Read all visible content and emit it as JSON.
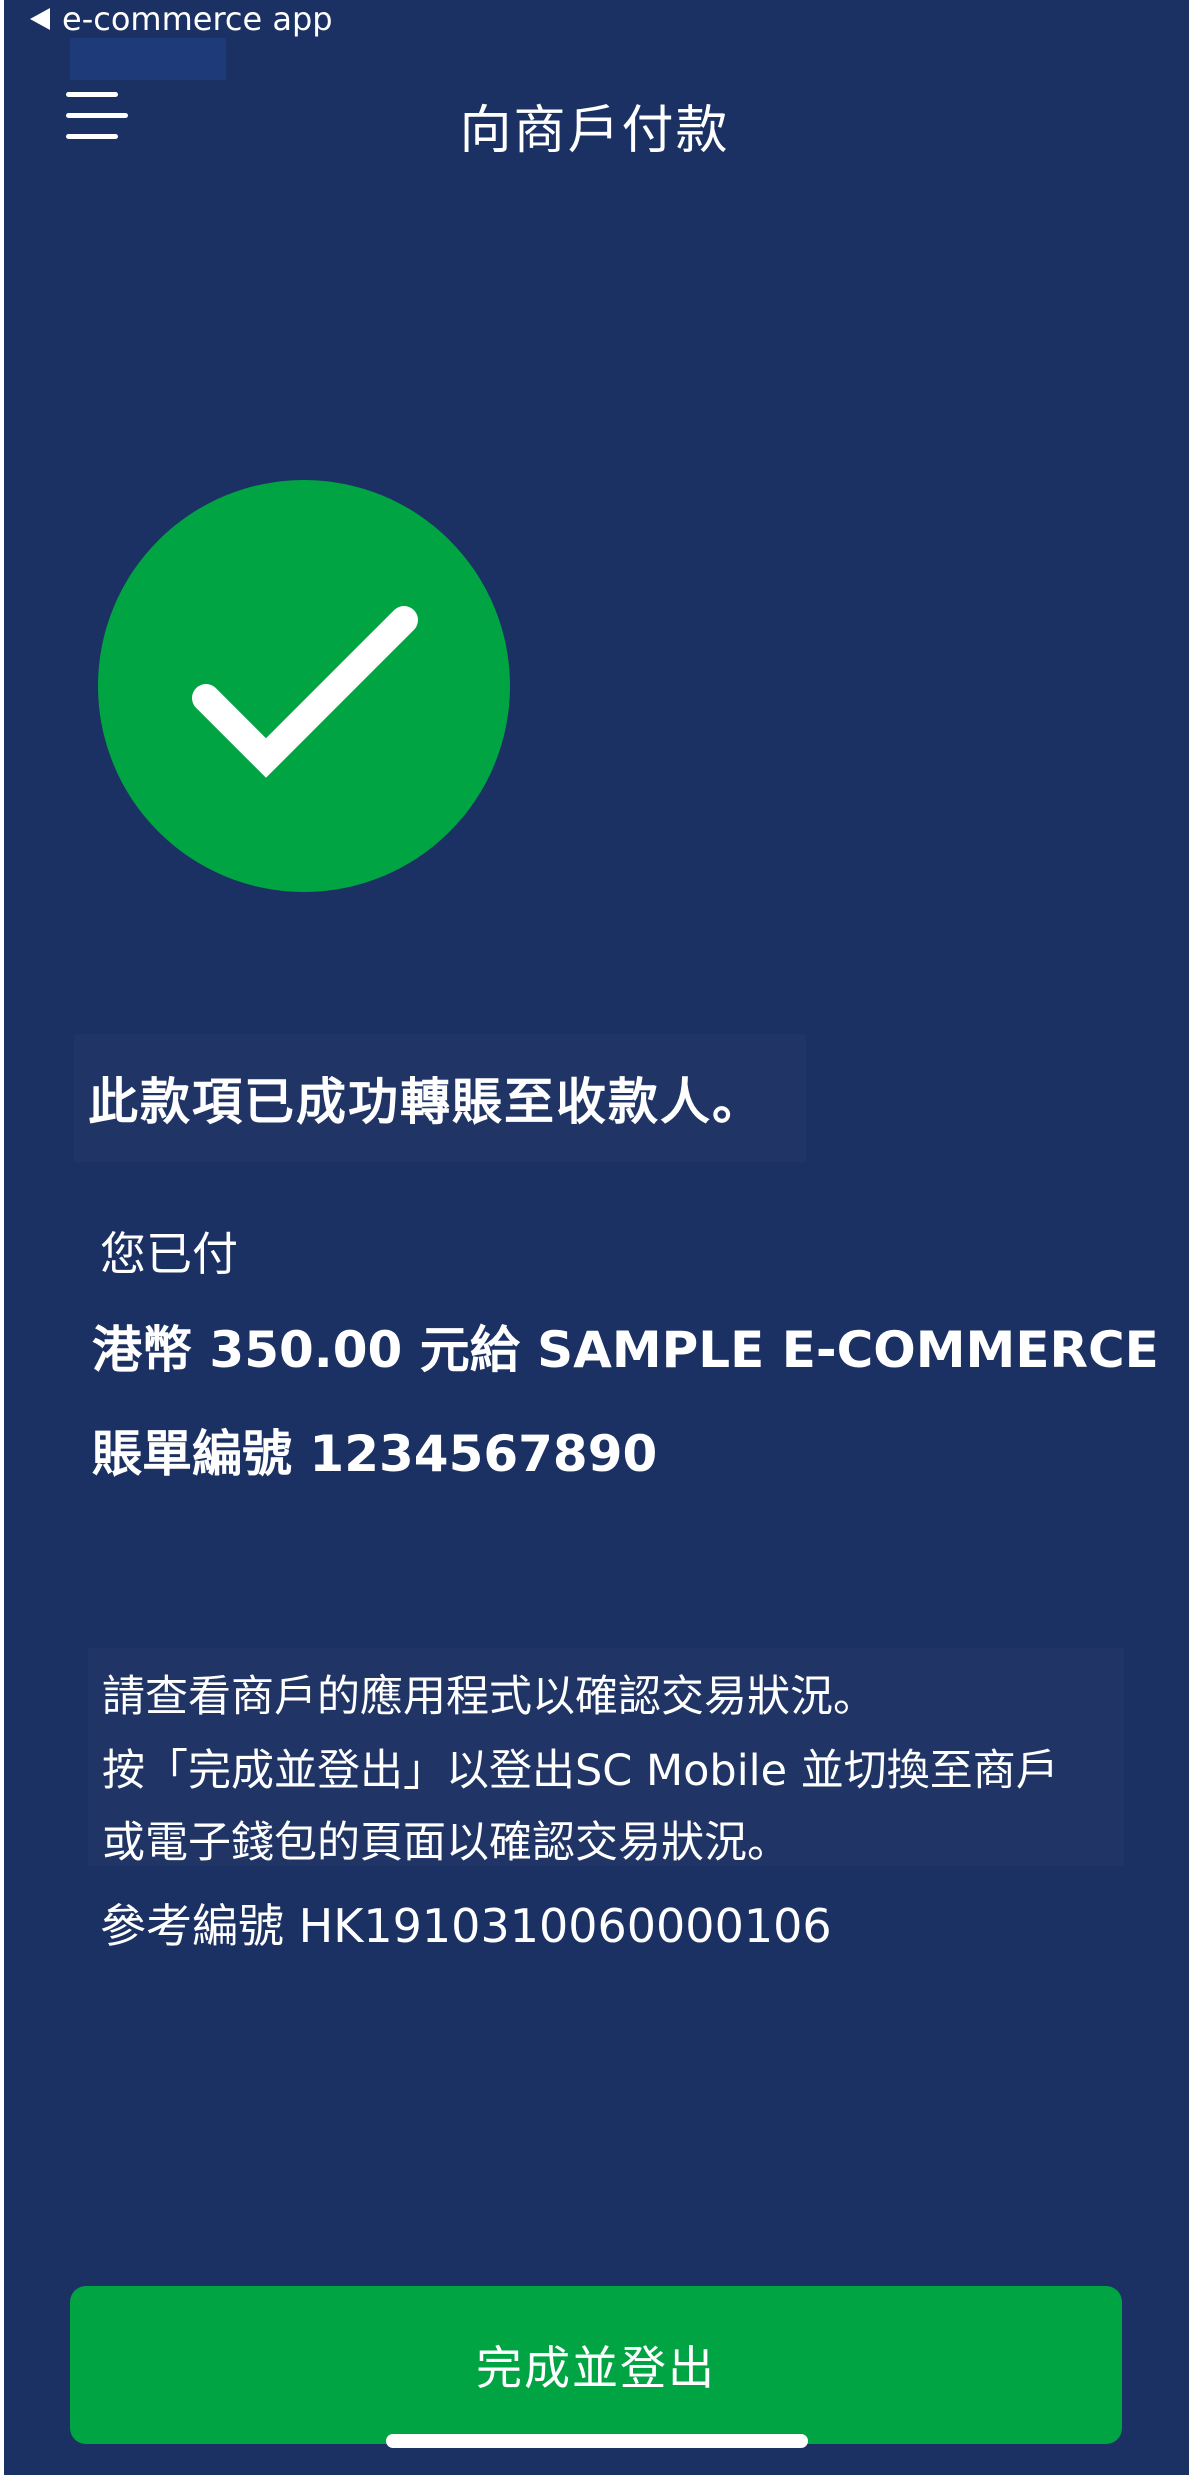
{
  "status_bar": {
    "back_app_label": "e-commerce app"
  },
  "header": {
    "title": "向商戶付款"
  },
  "icons": {
    "menu": "menu-icon",
    "success": "checkmark-icon",
    "back": "back-triangle-icon"
  },
  "colors": {
    "background": "#1b3163",
    "accent_green": "#00a443",
    "text": "#ffffff"
  },
  "main": {
    "success_message": "此款項已成功轉賬至收款人。",
    "paid_label": "您已付",
    "amount_line": "港幣 350.00 元給 SAMPLE E-COMMERCE",
    "bill_line": "賬單編號 1234567890",
    "info_lines": [
      "請查看商戶的應用程式以確認交易狀況。",
      "按「完成並登出」以登出SC Mobile 並切換至商戶",
      "或電子錢包的頁面以確認交易狀況。"
    ],
    "reference_line": "參考編號 HK1910310060000106"
  },
  "footer": {
    "done_button_label": "完成並登出"
  }
}
